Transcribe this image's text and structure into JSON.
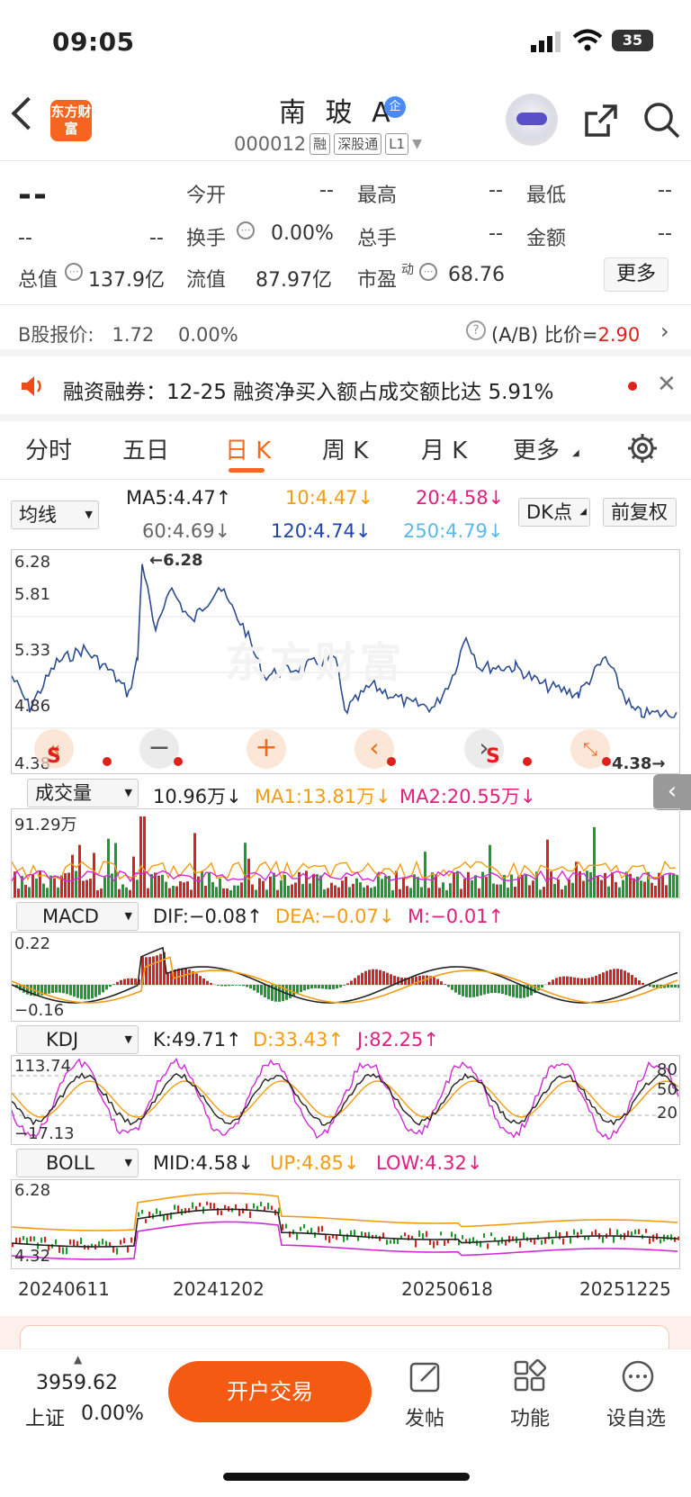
{
  "status_bar": {
    "time": "09:05",
    "battery": "35"
  },
  "header": {
    "logo_text": "东方财富",
    "stock_name": "南 玻 A",
    "badge": "企",
    "code": "000012",
    "tags": [
      "融",
      "深股通",
      "L1"
    ]
  },
  "quote": {
    "price": "--",
    "price_sub1": "--",
    "price_sub2": "--",
    "open_label": "今开",
    "open_value": "--",
    "high_label": "最高",
    "high_value": "--",
    "low_label": "最低",
    "low_value": "--",
    "turnover_label": "换手",
    "turnover_value": "0.00%",
    "volume_label": "总手",
    "volume_value": "--",
    "amount_label": "金额",
    "amount_value": "--",
    "mktcap_label": "总值",
    "mktcap_value": "137.9亿",
    "float_label": "流值",
    "float_value": "87.97亿",
    "pe_label": "市盈",
    "pe_sup": "动",
    "pe_value": "68.76",
    "more_button": "更多"
  },
  "b_share": {
    "label": "B股报价:",
    "price": "1.72",
    "change": "0.00%",
    "ratio_label": "(A/B) 比价=",
    "ratio_value": "2.90"
  },
  "notice": {
    "text": "融资融券：12-25 融资净买入额占成交额比达 5.91%"
  },
  "tabs": [
    "分时",
    "五日",
    "日 K",
    "周 K",
    "月 K",
    "更多"
  ],
  "active_tab": "日 K",
  "ma_row": {
    "selector": "均线",
    "ma5": "MA5:4.47↑",
    "ma10": "10:4.47↓",
    "ma20": "20:4.58↓",
    "ma60": "60:4.69↓",
    "ma120": "120:4.74↓",
    "ma250": "250:4.79↓",
    "dk_button": "DK点",
    "adjust_button": "前复权"
  },
  "colors": {
    "accent": "#f26a1b",
    "up": "#e0201c",
    "down": "#1a9e2a",
    "ma_blue": "#2c4d8f"
  },
  "kline": {
    "y_labels": [
      "6.28",
      "5.81",
      "5.33",
      "4.86",
      "4.38"
    ],
    "high_mark": "←6.28",
    "low_mark": "4.38→",
    "watermark": "东方财富",
    "s_markers": [
      "S",
      "S"
    ]
  },
  "volume_panel": {
    "selector": "成交量",
    "value": "10.96万↓",
    "ma1": "MA1:13.81万↓",
    "ma2": "MA2:20.55万↓",
    "y_label": "91.29万"
  },
  "macd_panel": {
    "selector": "MACD",
    "dif": "DIF:−0.08↑",
    "dea": "DEA:−0.07↓",
    "m": "M:−0.01↑",
    "y_top": "0.22",
    "y_bottom": "−0.16"
  },
  "kdj_panel": {
    "selector": "KDJ",
    "k": "K:49.71↑",
    "d": "D:33.43↑",
    "j": "J:82.25↑",
    "y_top": "113.74",
    "y_bottom": "−17.13",
    "right_labels": [
      "80",
      "50",
      "20"
    ]
  },
  "boll_panel": {
    "selector": "BOLL",
    "mid": "MID:4.58↓",
    "up": "UP:4.85↓",
    "low": "LOW:4.32↓",
    "y_top": "6.28",
    "y_bottom": "4.32"
  },
  "x_axis": [
    "20240611",
    "20241202",
    "20250618",
    "20251225"
  ],
  "bottom": {
    "index_value": "3959.62",
    "index_name": "上证",
    "index_change": "0.00%",
    "open_account": "开户交易",
    "post": "发帖",
    "functions": "功能",
    "add_watch": "设自选"
  }
}
